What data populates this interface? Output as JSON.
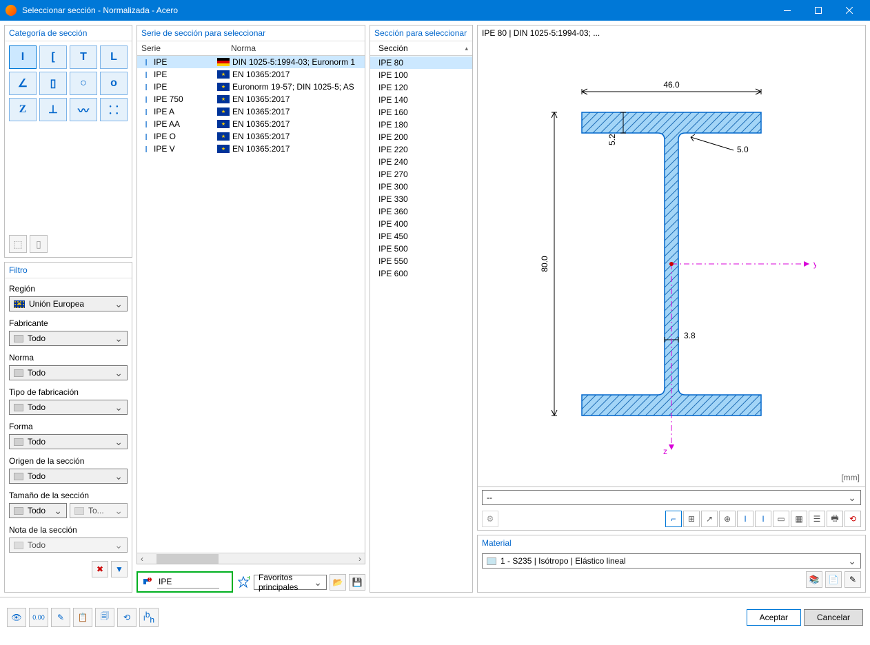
{
  "window": {
    "title": "Seleccionar sección - Normalizada - Acero"
  },
  "category": {
    "header": "Categoría de sección",
    "shapes": [
      "I",
      "C",
      "T",
      "L",
      "angle",
      "rect",
      "O",
      "o",
      "Z",
      "hat",
      "wave",
      "point"
    ]
  },
  "filter": {
    "header": "Filtro",
    "region_label": "Región",
    "region_value": "Unión Europea",
    "manufacturer_label": "Fabricante",
    "manufacturer_value": "Todo",
    "norm_label": "Norma",
    "norm_value": "Todo",
    "fabrication_label": "Tipo de fabricación",
    "fabrication_value": "Todo",
    "shape_label": "Forma",
    "shape_value": "Todo",
    "origin_label": "Origen de la sección",
    "origin_value": "Todo",
    "size_label": "Tamaño de la sección",
    "size_value1": "Todo",
    "size_value2": "To...",
    "note_label": "Nota de la sección",
    "note_value": "Todo"
  },
  "series_panel": {
    "header": "Serie de sección para seleccionar",
    "col_series": "Serie",
    "col_norm": "Norma",
    "rows": [
      {
        "name": "IPE",
        "flag": "de",
        "norm": "DIN 1025-5:1994-03; Euronorm 1"
      },
      {
        "name": "IPE",
        "flag": "eu",
        "norm": "EN 10365:2017"
      },
      {
        "name": "IPE",
        "flag": "eu",
        "norm": "Euronorm 19-57; DIN 1025-5; AS"
      },
      {
        "name": "IPE 750",
        "flag": "eu",
        "norm": "EN 10365:2017"
      },
      {
        "name": "IPE A",
        "flag": "eu",
        "norm": "EN 10365:2017"
      },
      {
        "name": "IPE AA",
        "flag": "eu",
        "norm": "EN 10365:2017"
      },
      {
        "name": "IPE O",
        "flag": "eu",
        "norm": "EN 10365:2017"
      },
      {
        "name": "IPE V",
        "flag": "eu",
        "norm": "EN 10365:2017"
      }
    ]
  },
  "sections_panel": {
    "header": "Sección para seleccionar",
    "col": "Sección",
    "rows": [
      "IPE 80",
      "IPE 100",
      "IPE 120",
      "IPE 140",
      "IPE 160",
      "IPE 180",
      "IPE 200",
      "IPE 220",
      "IPE 240",
      "IPE 270",
      "IPE 300",
      "IPE 330",
      "IPE 360",
      "IPE 400",
      "IPE 450",
      "IPE 500",
      "IPE 550",
      "IPE 600"
    ]
  },
  "preview": {
    "title": "IPE 80 | DIN 1025-5:1994-03; ...",
    "dims": {
      "width": "46.0",
      "height": "80.0",
      "flange": "5.2",
      "web": "3.8",
      "radius": "5.0"
    },
    "unit": "[mm]",
    "dropdown": "--"
  },
  "material": {
    "header": "Material",
    "value": "1 - S235 | Isótropo | Elástico lineal"
  },
  "search": {
    "value": "IPE",
    "favorites_label": "Favoritos principales"
  },
  "footer": {
    "accept": "Aceptar",
    "cancel": "Cancelar"
  }
}
